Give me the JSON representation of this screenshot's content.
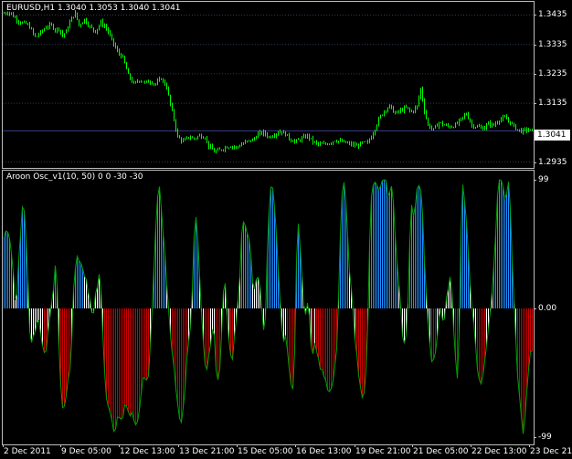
{
  "price_pane": {
    "title": "EURUSD,H1  1.3040 1.3053 1.3040 1.3041",
    "current_price": "1.3041",
    "y_labels": [
      {
        "text": "1.3435",
        "value": 1.3435
      },
      {
        "text": "1.3335",
        "value": 1.3335
      },
      {
        "text": "1.3235",
        "value": 1.3235
      },
      {
        "text": "1.3135",
        "value": 1.3135
      },
      {
        "text": "1.2935",
        "value": 1.2935
      }
    ],
    "candle_color": "#00ff00",
    "current_line_color": "#3b3b8a",
    "grid_color": "#2c3e50"
  },
  "osc_pane": {
    "title": "Aroon Osc_v1(10, 50) 0 0 -30 -30",
    "y_labels": [
      {
        "text": "99",
        "value": 99
      },
      {
        "text": "0.00",
        "value": 0
      },
      {
        "text": "-99",
        "value": -99
      }
    ],
    "colors": {
      "strong_up": "#1e90ff",
      "up": "#ffffff",
      "down": "#ffffff",
      "strong_down": "#cc0000",
      "outline": "#00a000"
    }
  },
  "time_axis": {
    "labels": [
      "2 Dec 2011",
      "9 Dec 05:00",
      "12 Dec 13:00",
      "13 Dec 21:00",
      "15 Dec 05:00",
      "16 Dec 13:00",
      "19 Dec 21:00",
      "21 Dec 05:00",
      "22 Dec 13:00",
      "23 Dec 21:00"
    ]
  },
  "chart_data": [
    {
      "type": "candlestick",
      "title": "EURUSD,H1  1.3040 1.3053 1.3040 1.3041",
      "ylim": [
        1.2915,
        1.348
      ],
      "x": [
        "2 Dec 2011",
        "9 Dec 05:00",
        "12 Dec 13:00",
        "13 Dec 21:00",
        "15 Dec 05:00",
        "16 Dec 13:00",
        "19 Dec 21:00",
        "21 Dec 05:00",
        "22 Dec 13:00",
        "23 Dec 21:00"
      ],
      "close": [
        1.344,
        1.339,
        1.333,
        1.322,
        1.301,
        1.301,
        1.302,
        1.306,
        1.307,
        1.3041
      ],
      "path_keypoints": [
        [
          0,
          1.344
        ],
        [
          8,
          1.3445
        ],
        [
          14,
          1.3425
        ],
        [
          20,
          1.341
        ],
        [
          26,
          1.3405
        ],
        [
          30,
          1.3395
        ],
        [
          36,
          1.336
        ],
        [
          42,
          1.3375
        ],
        [
          48,
          1.3395
        ],
        [
          54,
          1.34
        ],
        [
          58,
          1.3385
        ],
        [
          62,
          1.339
        ],
        [
          66,
          1.3365
        ],
        [
          70,
          1.338
        ],
        [
          76,
          1.3425
        ],
        [
          80,
          1.344
        ],
        [
          84,
          1.34
        ],
        [
          90,
          1.342
        ],
        [
          96,
          1.3395
        ],
        [
          102,
          1.338
        ],
        [
          108,
          1.341
        ],
        [
          114,
          1.339
        ],
        [
          120,
          1.335
        ],
        [
          126,
          1.331
        ],
        [
          132,
          1.329
        ],
        [
          138,
          1.323
        ],
        [
          144,
          1.32
        ],
        [
          150,
          1.3215
        ],
        [
          156,
          1.3205
        ],
        [
          162,
          1.321
        ],
        [
          168,
          1.32
        ],
        [
          174,
          1.322
        ],
        [
          180,
          1.319
        ],
        [
          184,
          1.313
        ],
        [
          188,
          1.308
        ],
        [
          192,
          1.302
        ],
        [
          198,
          1.3005
        ],
        [
          204,
          1.302
        ],
        [
          210,
          1.3015
        ],
        [
          216,
          1.3025
        ],
        [
          222,
          1.302
        ],
        [
          226,
          1.299
        ],
        [
          232,
          1.297
        ],
        [
          238,
          1.2975
        ],
        [
          244,
          1.2985
        ],
        [
          250,
          1.299
        ],
        [
          256,
          1.2985
        ],
        [
          262,
          1.2995
        ],
        [
          268,
          1.3005
        ],
        [
          274,
          1.301
        ],
        [
          280,
          1.303
        ],
        [
          286,
          1.3035
        ],
        [
          292,
          1.302
        ],
        [
          298,
          1.303
        ],
        [
          304,
          1.304
        ],
        [
          310,
          1.303
        ],
        [
          316,
          1.301
        ],
        [
          322,
          1.3005
        ],
        [
          328,
          1.3015
        ],
        [
          334,
          1.3025
        ],
        [
          340,
          1.3005
        ],
        [
          346,
          1.2995
        ],
        [
          352,
          1.2995
        ],
        [
          358,
          1.3
        ],
        [
          364,
          1.301
        ],
        [
          370,
          1.3005
        ],
        [
          376,
          1.3
        ],
        [
          382,
          1.2995
        ],
        [
          388,
          1.299
        ],
        [
          394,
          1.3
        ],
        [
          400,
          1.3
        ],
        [
          406,
          1.3035
        ],
        [
          412,
          1.308
        ],
        [
          418,
          1.311
        ],
        [
          424,
          1.3125
        ],
        [
          430,
          1.31
        ],
        [
          436,
          1.311
        ],
        [
          442,
          1.312
        ],
        [
          448,
          1.3105
        ],
        [
          454,
          1.3125
        ],
        [
          458,
          1.3185
        ],
        [
          462,
          1.311
        ],
        [
          466,
          1.306
        ],
        [
          472,
          1.3045
        ],
        [
          478,
          1.307
        ],
        [
          484,
          1.306
        ],
        [
          490,
          1.3055
        ],
        [
          496,
          1.306
        ],
        [
          502,
          1.308
        ],
        [
          508,
          1.31
        ],
        [
          514,
          1.306
        ],
        [
          520,
          1.3055
        ],
        [
          526,
          1.305
        ],
        [
          532,
          1.3065
        ],
        [
          538,
          1.306
        ],
        [
          544,
          1.308
        ],
        [
          550,
          1.3085
        ],
        [
          556,
          1.307
        ],
        [
          562,
          1.305
        ],
        [
          568,
          1.304
        ],
        [
          574,
          1.3045
        ],
        [
          580,
          1.3041
        ]
      ]
    },
    {
      "type": "bar",
      "title": "Aroon Osc_v1(10, 50) 0 0 -30 -30",
      "ylim": [
        -99,
        99
      ],
      "x": [
        "2 Dec 2011",
        "9 Dec 05:00",
        "12 Dec 13:00",
        "13 Dec 21:00",
        "15 Dec 05:00",
        "16 Dec 13:00",
        "19 Dec 21:00",
        "21 Dec 05:00",
        "22 Dec 13:00",
        "23 Dec 21:00"
      ],
      "threshold_up": 30,
      "threshold_down": -30,
      "profile_keypoints": [
        [
          0,
          55
        ],
        [
          4,
          65
        ],
        [
          8,
          48
        ],
        [
          12,
          20
        ],
        [
          14,
          -5
        ],
        [
          18,
          50
        ],
        [
          22,
          85
        ],
        [
          26,
          40
        ],
        [
          28,
          0
        ],
        [
          30,
          -30
        ],
        [
          34,
          -20
        ],
        [
          38,
          -5
        ],
        [
          42,
          -25
        ],
        [
          46,
          -40
        ],
        [
          50,
          -10
        ],
        [
          54,
          10
        ],
        [
          58,
          40
        ],
        [
          62,
          -55
        ],
        [
          66,
          -80
        ],
        [
          70,
          -60
        ],
        [
          74,
          -40
        ],
        [
          78,
          30
        ],
        [
          82,
          40
        ],
        [
          86,
          35
        ],
        [
          90,
          25
        ],
        [
          94,
          10
        ],
        [
          98,
          -10
        ],
        [
          102,
          15
        ],
        [
          106,
          30
        ],
        [
          110,
          -40
        ],
        [
          114,
          -75
        ],
        [
          118,
          -85
        ],
        [
          122,
          -95
        ],
        [
          126,
          -80
        ],
        [
          130,
          -90
        ],
        [
          134,
          -70
        ],
        [
          138,
          -85
        ],
        [
          142,
          -80
        ],
        [
          146,
          -95
        ],
        [
          150,
          -70
        ],
        [
          154,
          -50
        ],
        [
          158,
          -60
        ],
        [
          162,
          -20
        ],
        [
          166,
          50
        ],
        [
          170,
          99
        ],
        [
          174,
          70
        ],
        [
          178,
          30
        ],
        [
          182,
          -10
        ],
        [
          186,
          -40
        ],
        [
          190,
          -70
        ],
        [
          194,
          -90
        ],
        [
          198,
          -70
        ],
        [
          202,
          -30
        ],
        [
          206,
          -5
        ],
        [
          210,
          80
        ],
        [
          214,
          40
        ],
        [
          218,
          -15
        ],
        [
          222,
          -50
        ],
        [
          226,
          -30
        ],
        [
          230,
          -10
        ],
        [
          234,
          -60
        ],
        [
          238,
          -40
        ],
        [
          242,
          30
        ],
        [
          246,
          -20
        ],
        [
          250,
          -45
        ],
        [
          254,
          -15
        ],
        [
          258,
          10
        ],
        [
          262,
          70
        ],
        [
          266,
          60
        ],
        [
          270,
          50
        ],
        [
          274,
          10
        ],
        [
          278,
          30
        ],
        [
          282,
          15
        ],
        [
          286,
          -30
        ],
        [
          290,
          70
        ],
        [
          294,
          99
        ],
        [
          298,
          70
        ],
        [
          302,
          20
        ],
        [
          306,
          -30
        ],
        [
          310,
          -20
        ],
        [
          314,
          -55
        ],
        [
          318,
          -65
        ],
        [
          322,
          70
        ],
        [
          326,
          40
        ],
        [
          330,
          -10
        ],
        [
          334,
          5
        ],
        [
          338,
          -40
        ],
        [
          342,
          -25
        ],
        [
          346,
          -45
        ],
        [
          350,
          -50
        ],
        [
          354,
          -60
        ],
        [
          358,
          -65
        ],
        [
          362,
          -55
        ],
        [
          366,
          -20
        ],
        [
          370,
          85
        ],
        [
          374,
          99
        ],
        [
          378,
          40
        ],
        [
          382,
          5
        ],
        [
          386,
          -30
        ],
        [
          390,
          -55
        ],
        [
          394,
          -70
        ],
        [
          398,
          -45
        ],
        [
          402,
          80
        ],
        [
          406,
          99
        ],
        [
          410,
          90
        ],
        [
          414,
          95
        ],
        [
          418,
          99
        ],
        [
          422,
          85
        ],
        [
          426,
          99
        ],
        [
          430,
          40
        ],
        [
          434,
          15
        ],
        [
          438,
          -30
        ],
        [
          442,
          -20
        ],
        [
          446,
          80
        ],
        [
          450,
          70
        ],
        [
          454,
          99
        ],
        [
          458,
          90
        ],
        [
          462,
          20
        ],
        [
          466,
          -20
        ],
        [
          470,
          -45
        ],
        [
          474,
          -30
        ],
        [
          478,
          5
        ],
        [
          482,
          -10
        ],
        [
          486,
          10
        ],
        [
          490,
          30
        ],
        [
          494,
          -30
        ],
        [
          498,
          -60
        ],
        [
          502,
          99
        ],
        [
          506,
          80
        ],
        [
          510,
          30
        ],
        [
          514,
          -5
        ],
        [
          518,
          -40
        ],
        [
          522,
          -60
        ],
        [
          526,
          -45
        ],
        [
          530,
          -20
        ],
        [
          534,
          5
        ],
        [
          538,
          40
        ],
        [
          542,
          99
        ],
        [
          546,
          95
        ],
        [
          550,
          85
        ],
        [
          554,
          99
        ],
        [
          558,
          20
        ],
        [
          562,
          -40
        ],
        [
          566,
          -80
        ],
        [
          570,
          -98
        ],
        [
          574,
          -50
        ],
        [
          578,
          -30
        ],
        [
          580,
          -30
        ]
      ]
    }
  ]
}
